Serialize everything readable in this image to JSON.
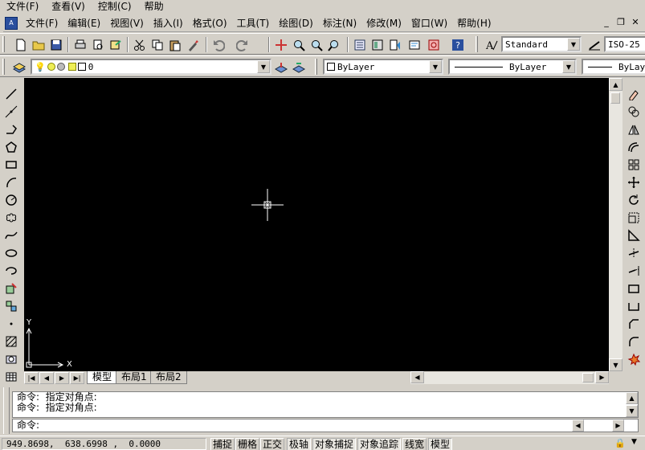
{
  "outer_menu": [
    "文件(F)",
    "查看(V)",
    "控制(C)",
    "帮助"
  ],
  "inner_menu": [
    "文件(F)",
    "编辑(E)",
    "视图(V)",
    "插入(I)",
    "格式(O)",
    "工具(T)",
    "绘图(D)",
    "标注(N)",
    "修改(M)",
    "窗口(W)",
    "帮助(H)"
  ],
  "window_buttons": [
    "_",
    "❐",
    "✕"
  ],
  "styles": {
    "text_style": "Standard",
    "dim_style": "ISO-25"
  },
  "layer": {
    "current": "0",
    "color": "ByLayer",
    "linetype": "ByLayer",
    "lineweight": "ByLaye"
  },
  "ucs": {
    "x_label": "X",
    "y_label": "Y"
  },
  "tabs": [
    {
      "label": "模型",
      "active": true
    },
    {
      "label": "布局1",
      "active": false
    },
    {
      "label": "布局2",
      "active": false
    }
  ],
  "command": {
    "history": [
      "命令:  指定对角点:",
      "命令:  指定对角点:"
    ],
    "prompt": "命令:"
  },
  "status": {
    "coords": "949.8698,  638.6998 ,  0.0000",
    "buttons": [
      {
        "label": "捕捉",
        "on": false
      },
      {
        "label": "栅格",
        "on": false
      },
      {
        "label": "正交",
        "on": false
      },
      {
        "label": "极轴",
        "on": true
      },
      {
        "label": "对象捕捉",
        "on": true
      },
      {
        "label": "对象追踪",
        "on": true
      },
      {
        "label": "线宽",
        "on": false
      },
      {
        "label": "模型",
        "on": true
      }
    ]
  },
  "colors": {
    "canvas": "#000000",
    "chrome": "#d4d0c8",
    "crosshair": "#ffffff"
  }
}
